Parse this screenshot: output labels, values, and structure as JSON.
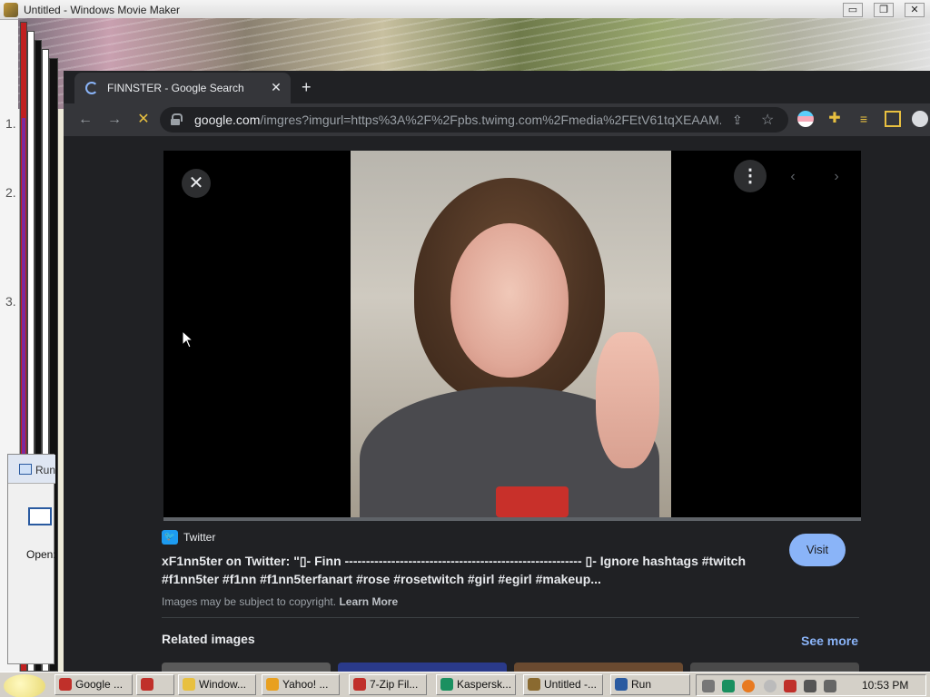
{
  "wmm": {
    "title": "Untitled - Windows Movie Maker",
    "controls": [
      "▭",
      "❐",
      "✕"
    ],
    "storyboard_numbers": [
      "1.",
      "2.",
      "3."
    ]
  },
  "run_dialog": {
    "title": "Run",
    "open_label": "Open:"
  },
  "chrome": {
    "tab_title": "FINNSTER - Google Search",
    "tab_close": "✕",
    "new_tab": "+",
    "url_host": "google.com",
    "url_path": "/imgres?imgurl=https%3A%2F%2Fpbs.twimg.com%2Fmedia%2FEtV61tqXEAAM...",
    "back": "←",
    "forward": "→",
    "stop": "✕"
  },
  "viewer": {
    "close": "✕",
    "more": "⋮",
    "prev": "‹",
    "next": "›"
  },
  "result": {
    "source": "Twitter",
    "caption": "xF1nn5ter on Twitter: \"▯- Finn -------------------------------------------------------- ▯- Ignore hashtags #twitch #f1nn5ter #f1nn #f1nn5terfanart #rose #rosetwitch #girl #egirl #makeup...",
    "visit": "Visit",
    "copyright": "Images may be subject to copyright.",
    "learn_more": "Learn More",
    "related": "Related images",
    "see_more": "See more"
  },
  "taskbar": {
    "items": [
      {
        "label": "Google ...",
        "color": "#c0302a"
      },
      {
        "label": "",
        "color": "#c0302a"
      },
      {
        "label": "Window...",
        "color": "#e8c040"
      },
      {
        "label": "Yahoo! ...",
        "color": "#e8a020"
      },
      {
        "label": "7-Zip Fil...",
        "color": "#c0302a"
      },
      {
        "label": "Kaspersk...",
        "color": "#1a9060"
      },
      {
        "label": "Untitled -...",
        "color": "#8a6a30"
      },
      {
        "label": "Run",
        "color": "#2a5aa0"
      }
    ],
    "clock": "10:53 PM"
  }
}
